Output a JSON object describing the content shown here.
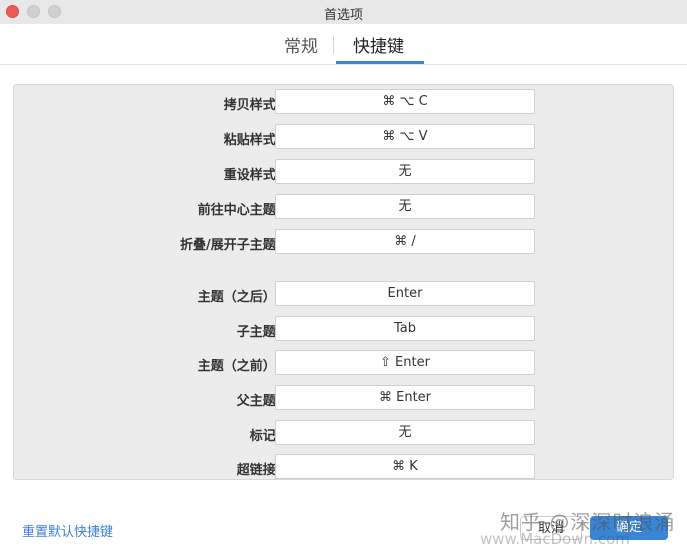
{
  "window": {
    "title": "首选项"
  },
  "tabs": [
    {
      "label": "常规"
    },
    {
      "label": "快捷键"
    }
  ],
  "shortcuts": [
    {
      "label": "拷贝样式:",
      "value": "⌘ ⌥ C"
    },
    {
      "label": "粘贴样式:",
      "value": "⌘ ⌥ V"
    },
    {
      "label": "重设样式:",
      "value": "无"
    },
    {
      "label": "前往中心主题:",
      "value": "无"
    },
    {
      "label": "折叠/展开子主题:",
      "value": "⌘ /"
    },
    {
      "label": "主题（之后）:",
      "value": "Enter"
    },
    {
      "label": "子主题:",
      "value": "Tab"
    },
    {
      "label": "主题（之前）:",
      "value": "⇧ Enter"
    },
    {
      "label": "父主题:",
      "value": "⌘ Enter"
    },
    {
      "label": "标记:",
      "value": "无"
    },
    {
      "label": "超链接:",
      "value": "⌘ K"
    }
  ],
  "footer": {
    "reset_label": "重置默认快捷键",
    "cancel_label": "取消",
    "ok_label": "确定",
    "watermark": "知乎 @深深时浪涌",
    "watermark_url": "www.MacDown.com"
  },
  "colors": {
    "accent": "#3a85d6",
    "link": "#3a7fd5"
  }
}
